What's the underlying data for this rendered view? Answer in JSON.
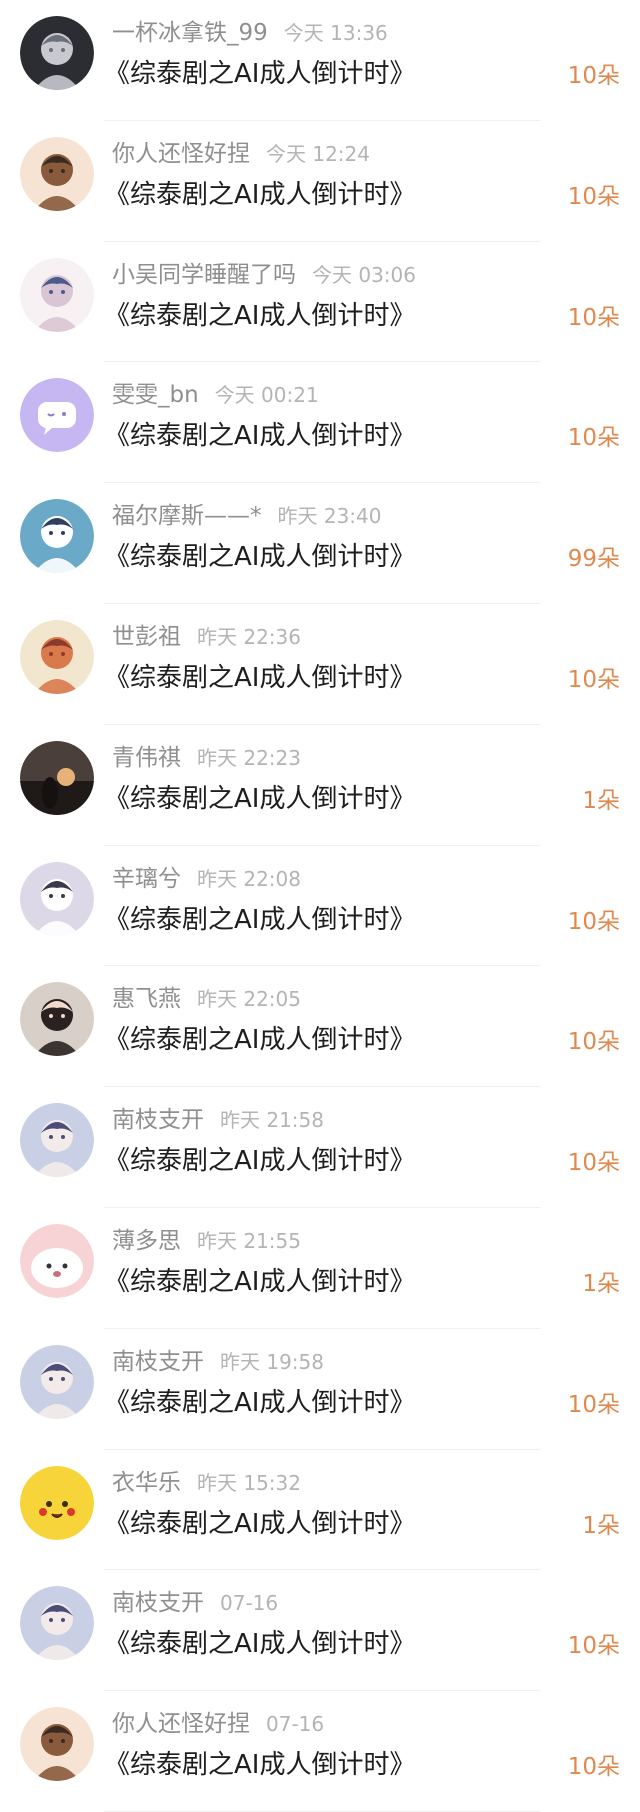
{
  "gifts": [
    {
      "name": "一杯冰拿铁_99",
      "time": "今天 13:36",
      "title": "《综泰剧之AI成人倒计时》",
      "amount": "10朵",
      "avatar": "dark-character-avatar",
      "colors": [
        "#2b2d33",
        "#c7c9cf",
        "#6b6f7a"
      ]
    },
    {
      "name": "你人还怪好捏",
      "time": "今天 12:24",
      "title": "《综泰剧之AI成人倒计时》",
      "amount": "10朵",
      "avatar": "anime-boy-eyes-avatar",
      "colors": [
        "#f6e3d4",
        "#8a5a3c",
        "#3a2b22"
      ]
    },
    {
      "name": "小吴同学睡醒了吗",
      "time": "今天 03:06",
      "title": "《综泰剧之AI成人倒计时》",
      "amount": "10朵",
      "avatar": "sketch-girl-avatar",
      "colors": [
        "#f7f1f4",
        "#d9c5d3",
        "#4b5b8c"
      ]
    },
    {
      "name": "雯雯_bn",
      "time": "今天 00:21",
      "title": "《综泰剧之AI成人倒计时》",
      "amount": "10朵",
      "avatar": "chat-bubble-avatar",
      "colors": [
        "#c6b6f1",
        "#ffffff",
        "#8b79c9"
      ]
    },
    {
      "name": "福尔摩斯——*",
      "time": "昨天 23:40",
      "title": "《综泰剧之AI成人倒计时》",
      "amount": "99朵",
      "avatar": "tennis-boy-avatar",
      "colors": [
        "#6aa9c7",
        "#ffffff",
        "#2f3f5c"
      ]
    },
    {
      "name": "世彭祖",
      "time": "昨天 22:36",
      "title": "《综泰剧之AI成人倒计时》",
      "amount": "10朵",
      "avatar": "cartoon-boy-avatar",
      "colors": [
        "#f2e6cf",
        "#d9794c",
        "#8b3b2b"
      ]
    },
    {
      "name": "青伟祺",
      "time": "昨天 22:23",
      "title": "《综泰剧之AI成人倒计时》",
      "amount": "1朵",
      "avatar": "sunset-girl-avatar",
      "colors": [
        "#4a3f3a",
        "#e6b27a",
        "#1f1a18"
      ]
    },
    {
      "name": "辛璃兮",
      "time": "昨天 22:08",
      "title": "《综泰剧之AI成人倒计时》",
      "amount": "10朵",
      "avatar": "illustrated-girl-avatar",
      "colors": [
        "#dcd8e8",
        "#ffffff",
        "#3c3a4a"
      ]
    },
    {
      "name": "惠飞燕",
      "time": "昨天 22:05",
      "title": "《综泰剧之AI成人倒计时》",
      "amount": "10朵",
      "avatar": "portrait-girl-avatar",
      "colors": [
        "#d8cfc8",
        "#2a2220",
        "#f1d9cc"
      ]
    },
    {
      "name": "南枝支开",
      "time": "昨天 21:58",
      "title": "《综泰剧之AI成人倒计时》",
      "amount": "10朵",
      "avatar": "anime-man-avatar",
      "colors": [
        "#c9cfe4",
        "#f3ebe9",
        "#4b4d78"
      ]
    },
    {
      "name": "薄多思",
      "time": "昨天 21:55",
      "title": "《综泰剧之AI成人倒计时》",
      "amount": "1朵",
      "avatar": "pink-blob-avatar",
      "colors": [
        "#f7d3d6",
        "#ffffff",
        "#c9707c"
      ]
    },
    {
      "name": "南枝支开",
      "time": "昨天 19:58",
      "title": "《综泰剧之AI成人倒计时》",
      "amount": "10朵",
      "avatar": "anime-man-avatar",
      "colors": [
        "#c9cfe4",
        "#f3ebe9",
        "#4b4d78"
      ]
    },
    {
      "name": "衣华乐",
      "time": "昨天 15:32",
      "title": "《综泰剧之AI成人倒计时》",
      "amount": "1朵",
      "avatar": "pikachu-avatar",
      "colors": [
        "#f6d43a",
        "#d93a2b",
        "#3a2e12"
      ]
    },
    {
      "name": "南枝支开",
      "time": "07-16",
      "title": "《综泰剧之AI成人倒计时》",
      "amount": "10朵",
      "avatar": "anime-man-avatar",
      "colors": [
        "#c9cfe4",
        "#f3ebe9",
        "#4b4d78"
      ]
    },
    {
      "name": "你人还怪好捏",
      "time": "07-16",
      "title": "《综泰剧之AI成人倒计时》",
      "amount": "10朵",
      "avatar": "anime-boy-eyes-avatar",
      "colors": [
        "#f6e3d4",
        "#8a5a3c",
        "#3a2b22"
      ]
    }
  ]
}
